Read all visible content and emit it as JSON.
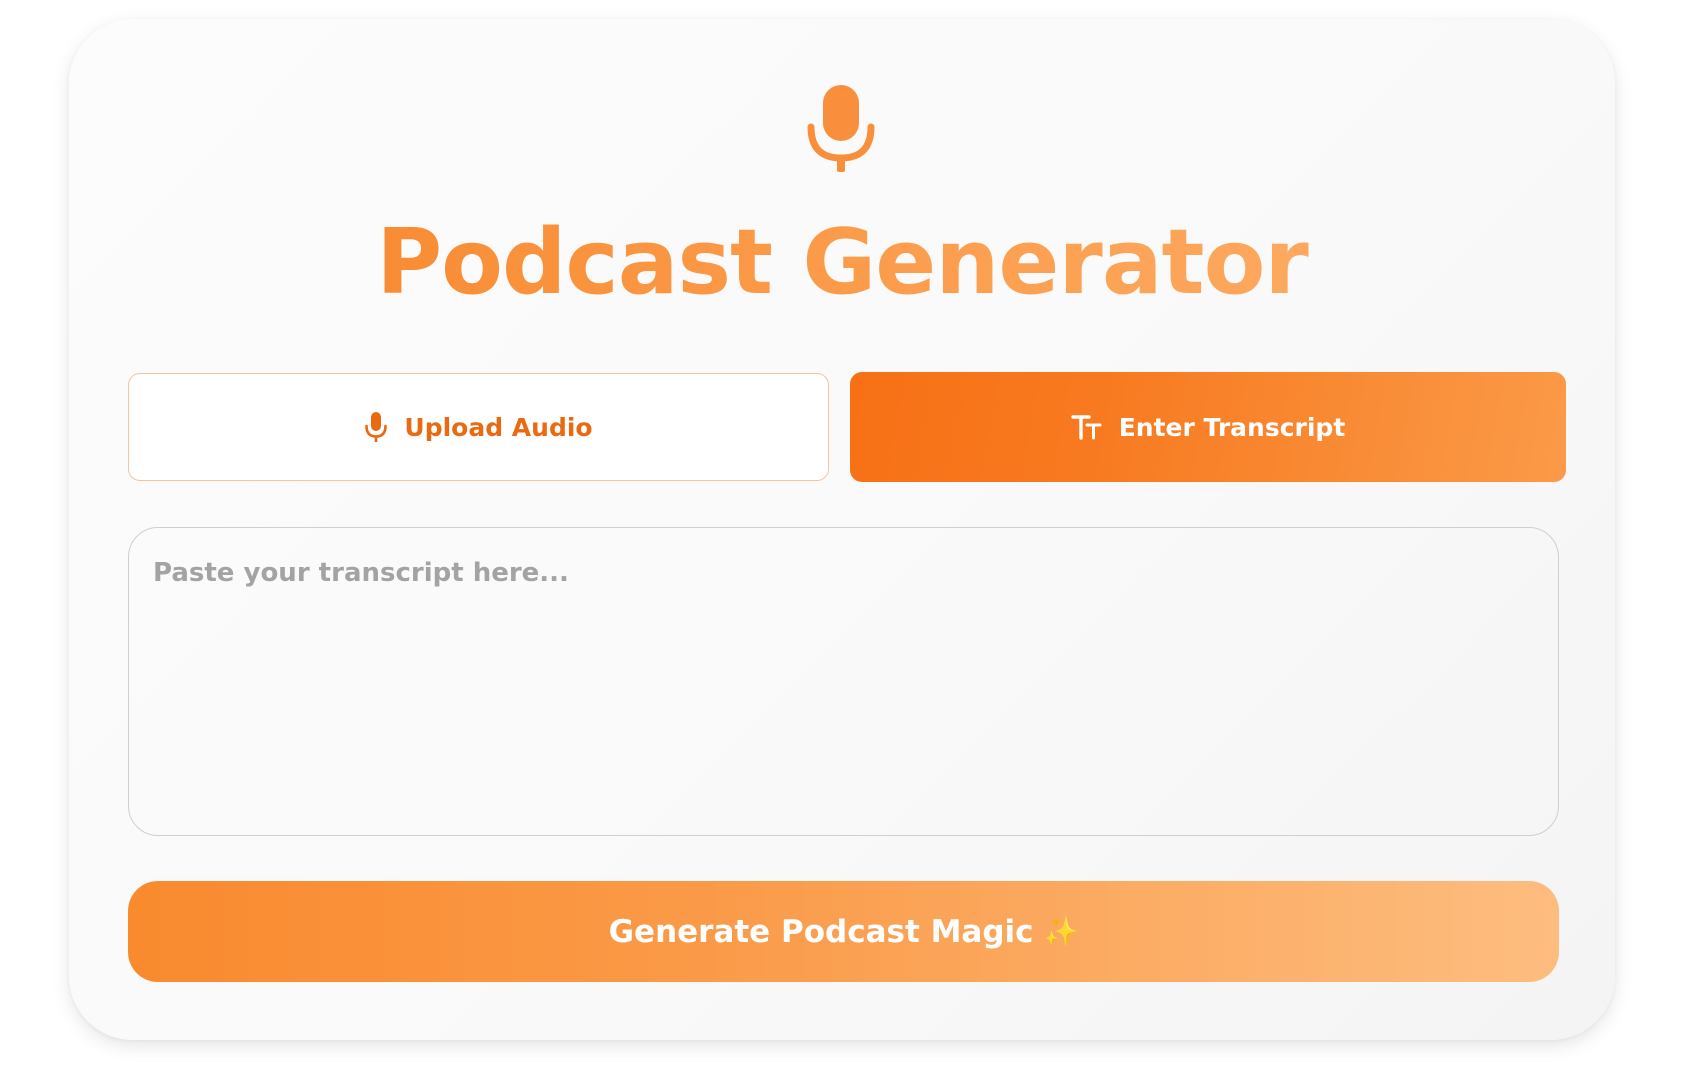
{
  "app": {
    "title": "Podcast Generator",
    "logo_icon": "microphone-icon"
  },
  "tabs": [
    {
      "label": "Upload Audio",
      "icon": "microphone-icon",
      "active": false
    },
    {
      "label": "Enter Transcript",
      "icon": "text-size-icon",
      "active": true
    }
  ],
  "transcript": {
    "placeholder": "Paste your transcript here...",
    "value": ""
  },
  "generate_button": {
    "label": "Generate Podcast Magic",
    "icon": "sparkles-icon",
    "glyph": "✨"
  },
  "colors": {
    "accent": "#f77015",
    "accent_light": "#fdbd7f",
    "upload_text": "#ea6a12"
  }
}
